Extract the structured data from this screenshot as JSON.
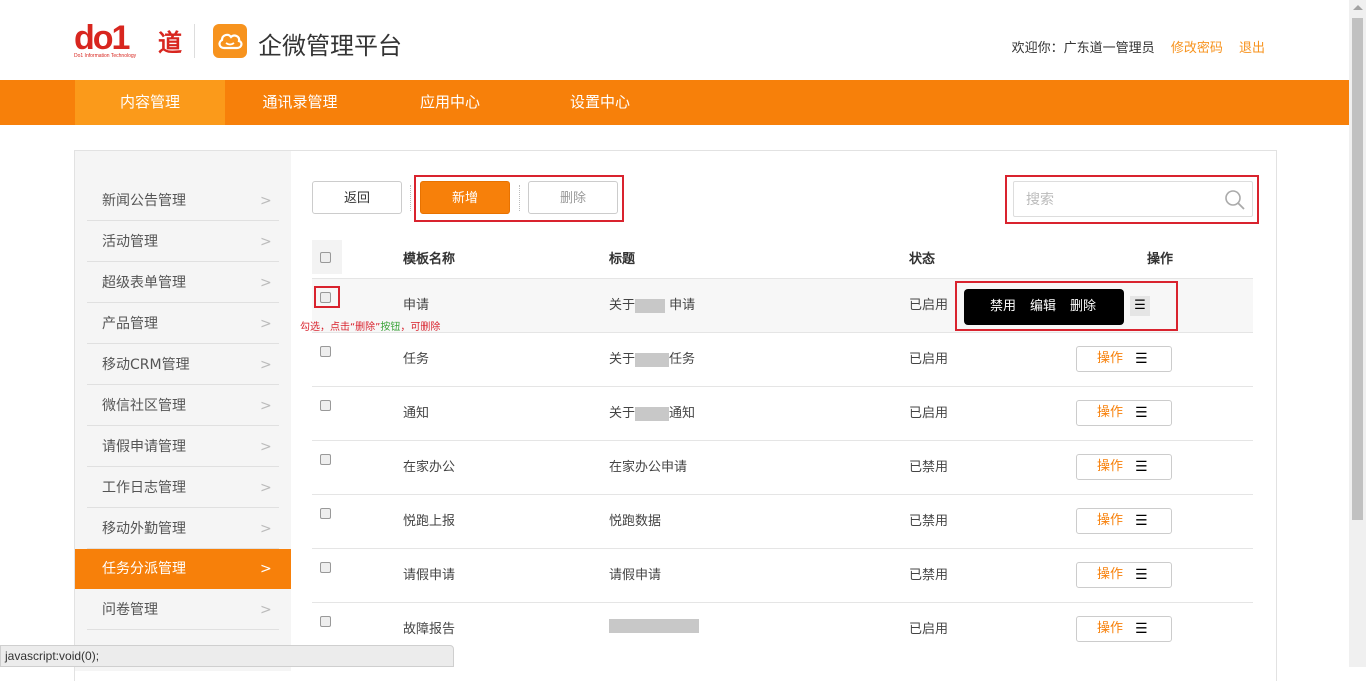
{
  "header": {
    "logo_text": "do1",
    "logo_char": "道",
    "logo_sub": "Do1 Information Technology",
    "app_title": "企微管理平台",
    "welcome": "欢迎你：广东道一管理员",
    "change_password": "修改密码",
    "logout": "退出"
  },
  "nav": {
    "items": [
      {
        "label": "内容管理",
        "active": true
      },
      {
        "label": "通讯录管理",
        "active": false
      },
      {
        "label": "应用中心",
        "active": false
      },
      {
        "label": "设置中心",
        "active": false
      }
    ]
  },
  "sidebar": {
    "items": [
      {
        "label": "新闻公告管理"
      },
      {
        "label": "活动管理"
      },
      {
        "label": "超级表单管理"
      },
      {
        "label": "产品管理"
      },
      {
        "label": "移动CRM管理"
      },
      {
        "label": "微信社区管理"
      },
      {
        "label": "请假申请管理"
      },
      {
        "label": "工作日志管理"
      },
      {
        "label": "移动外勤管理"
      },
      {
        "label": "任务分派管理",
        "active": true
      },
      {
        "label": "问卷管理"
      }
    ]
  },
  "toolbar": {
    "back_label": "返回",
    "add_label": "新增",
    "delete_label": "删除",
    "search_placeholder": "搜索"
  },
  "table": {
    "headers": {
      "name": "模板名称",
      "title": "标题",
      "status": "状态",
      "ops": "操作"
    },
    "op_label": "操作",
    "rows": [
      {
        "name": "申请",
        "title_prefix": "关于",
        "title_suffix": " 申请",
        "status": "已启用"
      },
      {
        "name": "任务",
        "title_prefix": "关于",
        "title_suffix": "任务",
        "status": "已启用"
      },
      {
        "name": "通知",
        "title_prefix": "关于",
        "title_suffix": "通知",
        "status": "已启用"
      },
      {
        "name": "在家办公",
        "title_prefix": "在家办公申请",
        "title_suffix": "",
        "status": "已禁用"
      },
      {
        "name": "悦跑上报",
        "title_prefix": "悦跑数据",
        "title_suffix": "",
        "status": "已禁用"
      },
      {
        "name": "请假申请",
        "title_prefix": "请假申请",
        "title_suffix": "",
        "status": "已禁用"
      },
      {
        "name": "故障报告",
        "title_prefix": "",
        "title_suffix": "",
        "status": "已启用"
      }
    ]
  },
  "popup": {
    "disable": "禁用",
    "edit": "编辑",
    "delete": "删除"
  },
  "hint": {
    "part1": "勾选，点击“删除”",
    "part2": "按钮",
    "part3": "，可删除"
  },
  "statusbar": {
    "text": "javascript:void(0);"
  },
  "colors": {
    "brand_orange": "#f7800a",
    "annotation_red": "#d9232e"
  }
}
